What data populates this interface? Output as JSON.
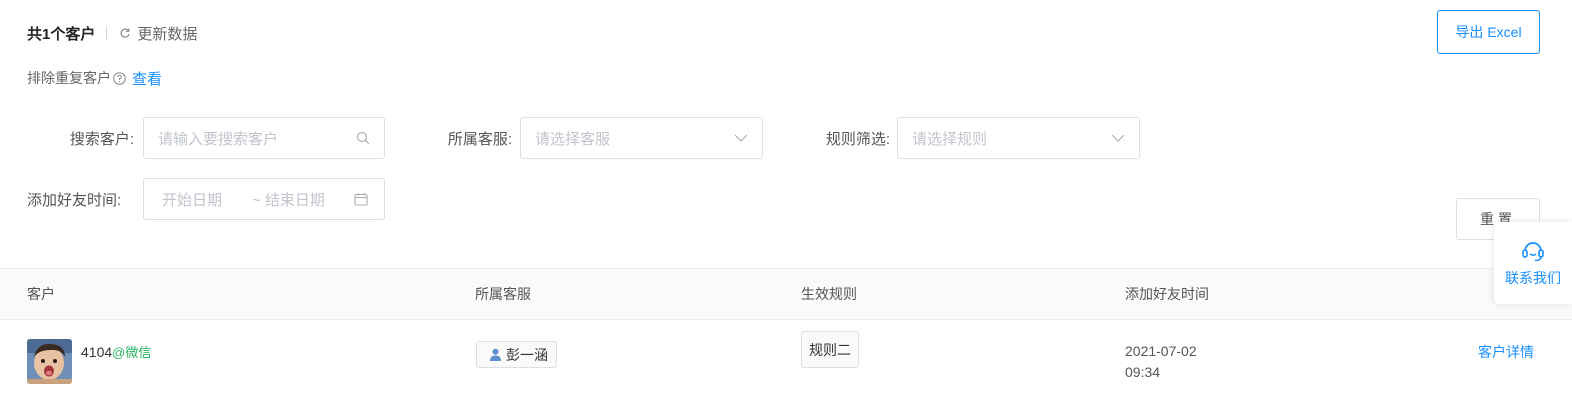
{
  "summary": {
    "count_text": "共1个客户",
    "refresh_label": "更新数据"
  },
  "export": {
    "label": "导出 Excel"
  },
  "exclude": {
    "label": "排除重复客户",
    "link": "查看"
  },
  "filters": {
    "search": {
      "label": "搜索客户:",
      "placeholder": "请输入要搜索客户"
    },
    "staff": {
      "label": "所属客服:",
      "placeholder": "请选择客服"
    },
    "rule": {
      "label": "规则筛选:",
      "placeholder": "请选择规则"
    },
    "date": {
      "label": "添加好友时间:",
      "start_placeholder": "开始日期",
      "end_placeholder": "~ 结束日期"
    }
  },
  "reset": {
    "label": "重置"
  },
  "contact": {
    "label": "联系我们"
  },
  "table": {
    "headers": [
      "客户",
      "所属客服",
      "生效规则",
      "添加好友时间"
    ],
    "rows": [
      {
        "name": "4104",
        "source": "@微信",
        "staff": "彭一涵",
        "rule": "规则二",
        "date": "2021-07-02",
        "time": "09:34",
        "action": "客户详情"
      }
    ]
  },
  "colors": {
    "accent": "#1890ff",
    "wechat_green": "#22b35e",
    "border": "#dcdfe6"
  },
  "icons": [
    "refresh-icon",
    "help-circle-icon",
    "search-icon",
    "chevron-down-icon",
    "calendar-icon",
    "headset-icon",
    "user-icon"
  ]
}
